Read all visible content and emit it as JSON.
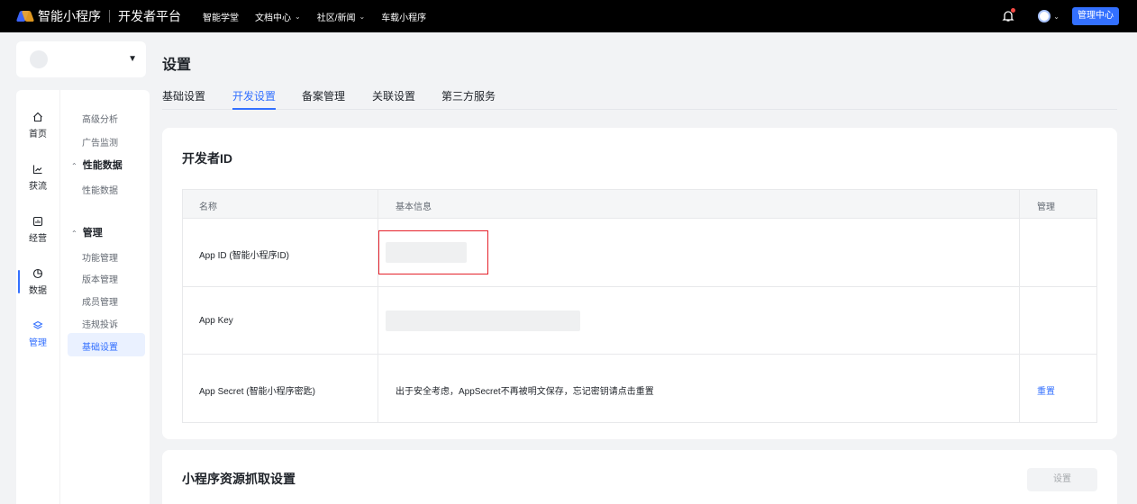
{
  "topbar": {
    "brand": "智能小程序",
    "platform": "开发者平台",
    "nav": [
      {
        "label": "智能学堂",
        "dropdown": false
      },
      {
        "label": "文档中心",
        "dropdown": true
      },
      {
        "label": "社区/新闻",
        "dropdown": true
      },
      {
        "label": "车载小程序",
        "dropdown": false
      }
    ],
    "admin_button": "管理中心"
  },
  "rail": {
    "items": [
      {
        "label": "首页",
        "icon": "home-icon"
      },
      {
        "label": "获流",
        "icon": "chart-icon"
      },
      {
        "label": "经营",
        "icon": "operate-icon"
      },
      {
        "label": "数据",
        "icon": "pie-icon"
      },
      {
        "label": "管理",
        "icon": "layers-icon"
      }
    ]
  },
  "subnav": {
    "items_top": [
      "高级分析",
      "广告监测"
    ],
    "group_perf": "性能数据",
    "perf_items": [
      "性能数据"
    ],
    "group_manage": "管理",
    "manage_items": [
      "功能管理",
      "版本管理",
      "成员管理",
      "违规投诉",
      "基础设置"
    ]
  },
  "page": {
    "title": "设置",
    "tabs": [
      "基础设置",
      "开发设置",
      "备案管理",
      "关联设置",
      "第三方服务"
    ],
    "active_tab": "开发设置"
  },
  "developer_card": {
    "title": "开发者ID",
    "columns": [
      "名称",
      "基本信息",
      "管理"
    ],
    "rows": [
      {
        "label": "App ID (智能小程序ID)",
        "value": "",
        "action": ""
      },
      {
        "label": "App Key",
        "value": "",
        "action": ""
      },
      {
        "label": "App Secret (智能小程序密匙)",
        "value": "出于安全考虑，AppSecret不再被明文保存，忘记密钥请点击重置",
        "action": "重置"
      }
    ]
  },
  "resource_card": {
    "title": "小程序资源抓取设置",
    "button": "设置"
  },
  "colors": {
    "accent": "#3370ff",
    "highlight": "#e5212a",
    "topbar": "#000000"
  }
}
